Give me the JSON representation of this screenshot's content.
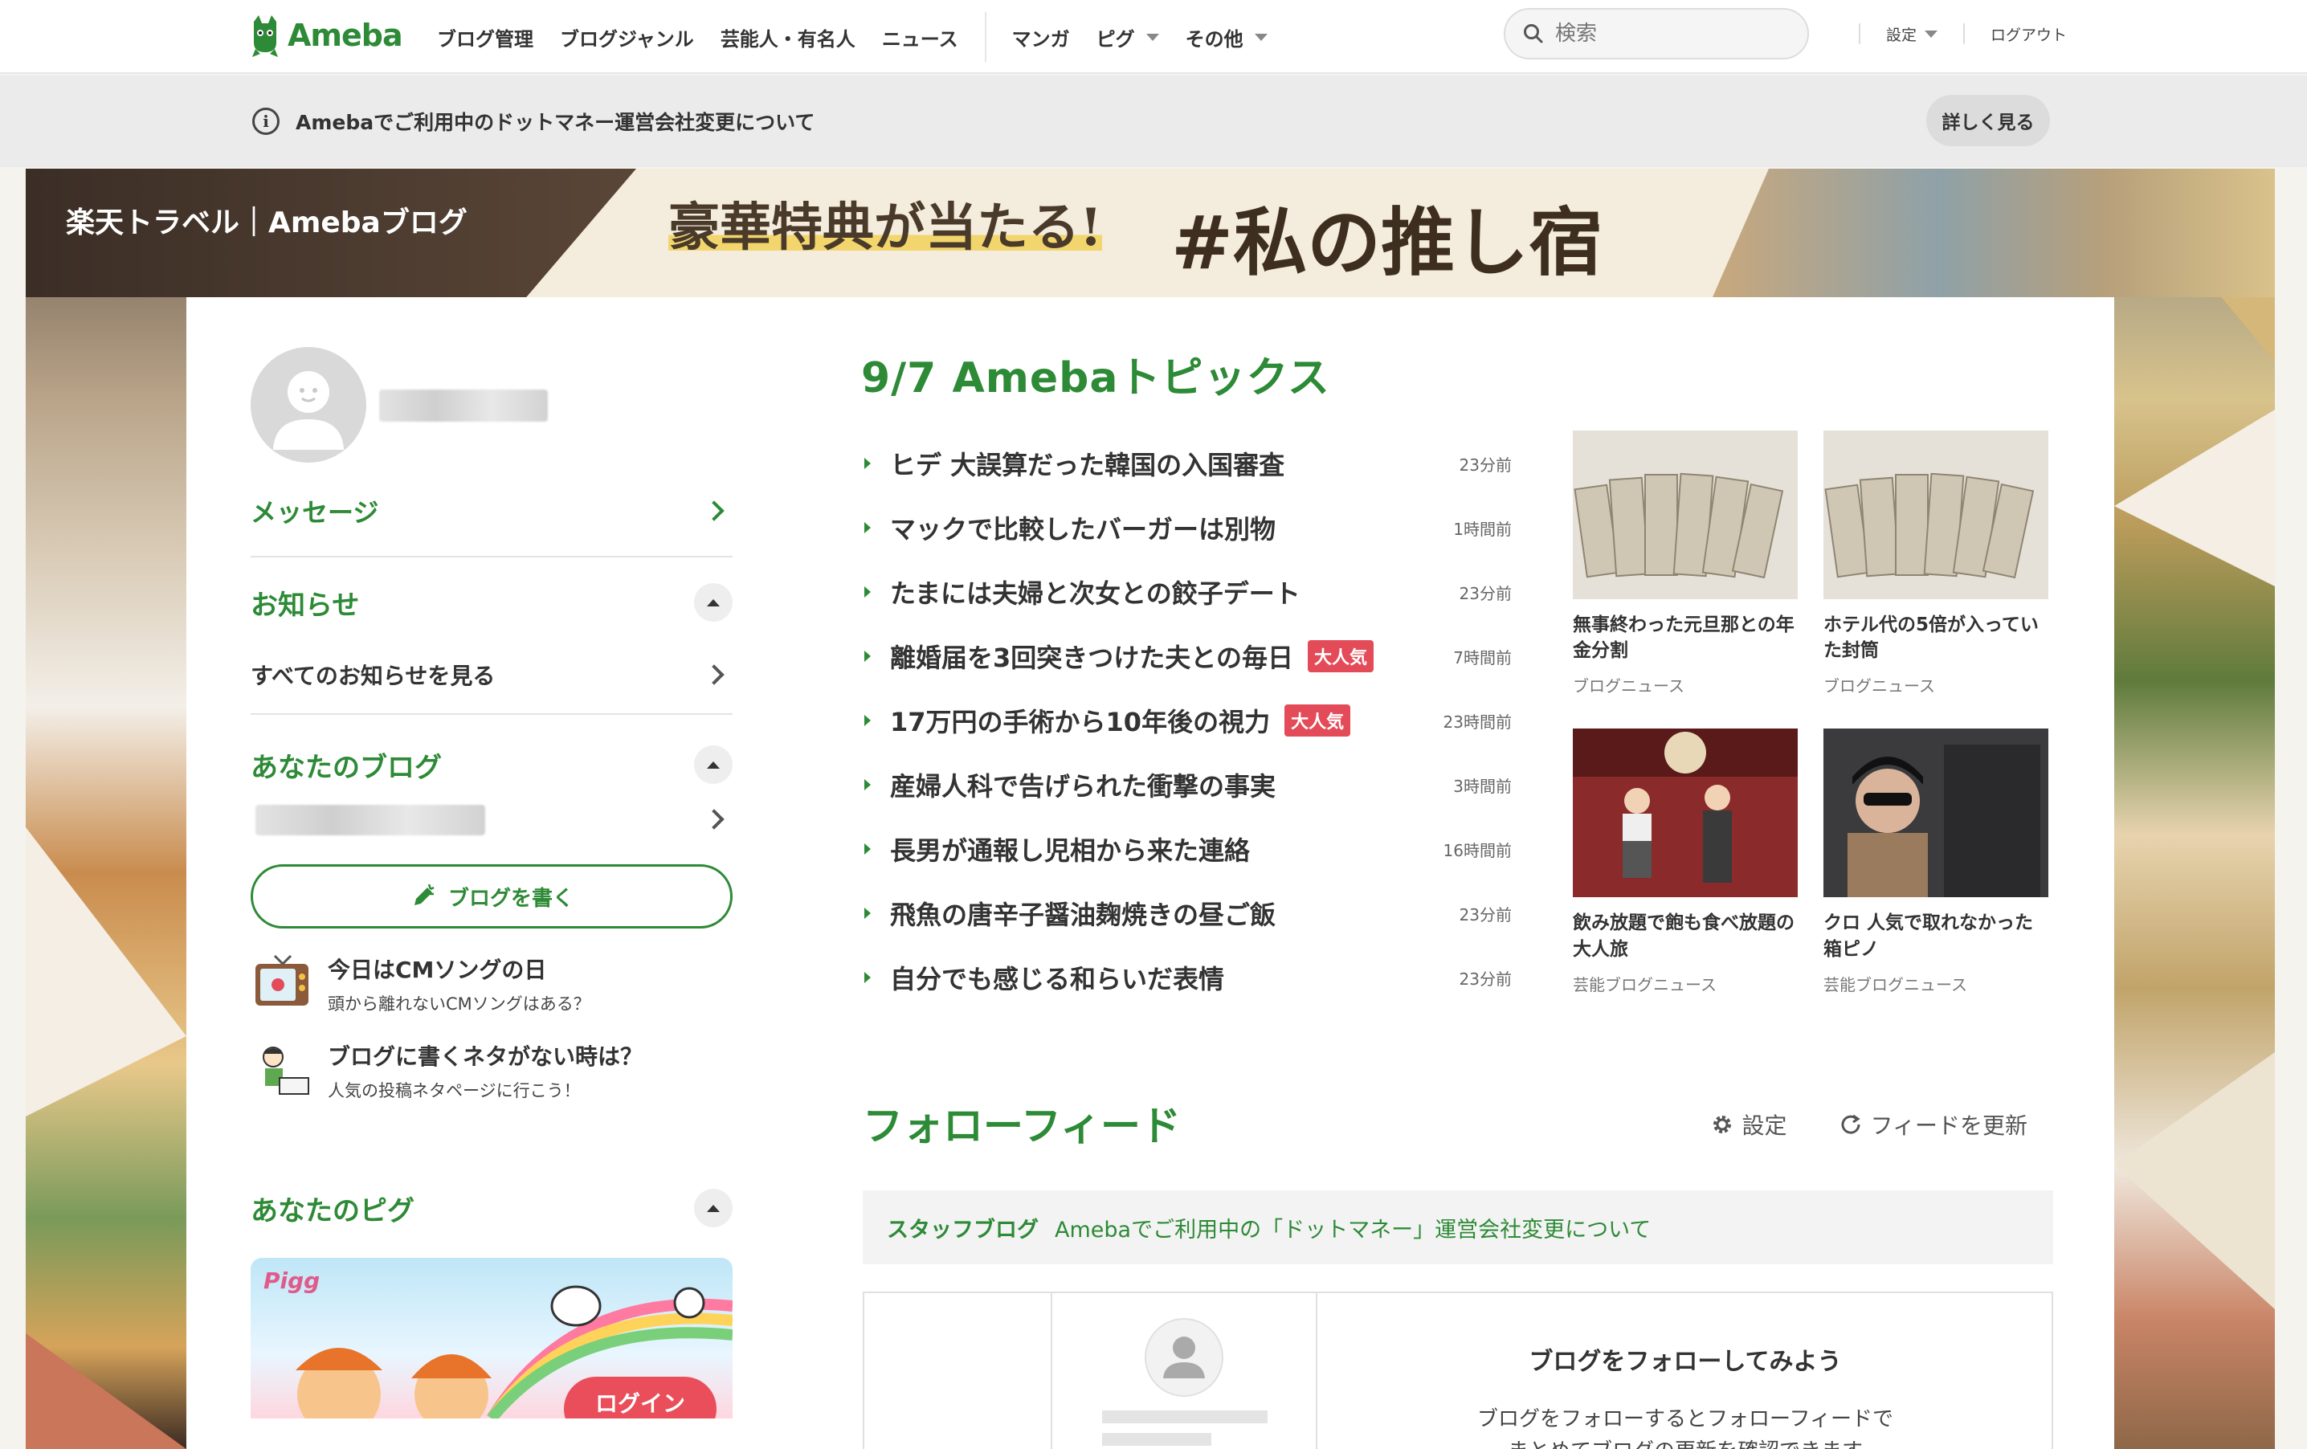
{
  "header": {
    "logo_text": "Ameba",
    "nav": [
      "ブログ管理",
      "ブログジャンル",
      "芸能人・有名人",
      "ニュース",
      "マンガ",
      "ピグ",
      "その他"
    ],
    "search_placeholder": "検索",
    "settings": "設定",
    "logout": "ログアウト"
  },
  "notice": {
    "text": "Amebaでご利用中のドットマネー運営会社変更について",
    "button": "詳しく見る"
  },
  "banner": {
    "label": "楽天トラベル｜Amebaブログ",
    "title": "豪華特典が当たる!",
    "tag": "#私の推し宿"
  },
  "sidebar": {
    "message": "メッセージ",
    "news_heading": "お知らせ",
    "all_news": "すべてのお知らせを見る",
    "blog_heading": "あなたのブログ",
    "write_button": "ブログを書く",
    "tips": [
      {
        "title": "今日はCMソングの日",
        "sub": "頭から離れないCMソングはある？"
      },
      {
        "title": "ブログに書くネタがない時は？",
        "sub": "人気の投稿ネタページに行こう！"
      }
    ],
    "pigg_heading": "あなたのピグ",
    "pigg_logo": "Pigg",
    "pigg_login": "ログイン"
  },
  "topics": {
    "title": "9/7 Amebaトピックス",
    "items": [
      {
        "text": "ヒデ 大誤算だった韓国の入国審査",
        "time": "23分前",
        "badge": ""
      },
      {
        "text": "マックで比較したバーガーは別物",
        "time": "1時間前",
        "badge": ""
      },
      {
        "text": "たまには夫婦と次女との餃子デート",
        "time": "23分前",
        "badge": ""
      },
      {
        "text": "離婚届を3回突きつけた夫との毎日",
        "time": "7時間前",
        "badge": "大人気"
      },
      {
        "text": "17万円の手術から10年後の視力",
        "time": "23時間前",
        "badge": "大人気"
      },
      {
        "text": "産婦人科で告げられた衝撃の事実",
        "time": "3時間前",
        "badge": ""
      },
      {
        "text": "長男が通報し児相から来た連絡",
        "time": "16時間前",
        "badge": ""
      },
      {
        "text": "飛魚の唐辛子醤油麹焼きの昼ご飯",
        "time": "23分前",
        "badge": ""
      },
      {
        "text": "自分でも感じる和らいだ表情",
        "time": "23分前",
        "badge": ""
      }
    ]
  },
  "picks": [
    {
      "title": "無事終わった元旦那との年金分割",
      "source": "ブログニュース"
    },
    {
      "title": "ホテル代の5倍が入っていた封筒",
      "source": "ブログニュース"
    },
    {
      "title": "飲み放題で飽も食べ放題の大人旅",
      "source": "芸能ブログニュース"
    },
    {
      "title": "クロ 人気で取れなかった箱ピノ",
      "source": "芸能ブログニュース"
    }
  ],
  "feed": {
    "title": "フォローフィード",
    "settings": "設定",
    "refresh": "フィードを更新",
    "staff_label": "スタッフブログ",
    "staff_text": "Amebaでご利用中の「ドットマネー」運営会社変更について",
    "empty_title": "ブログをフォローしてみよう",
    "empty_text_1": "ブログをフォローするとフォローフィードで",
    "empty_text_2": "まとめてブログの更新を確認できます"
  },
  "colors": {
    "brand_green": "#2d8a36",
    "badge_red": "#e34b59"
  }
}
